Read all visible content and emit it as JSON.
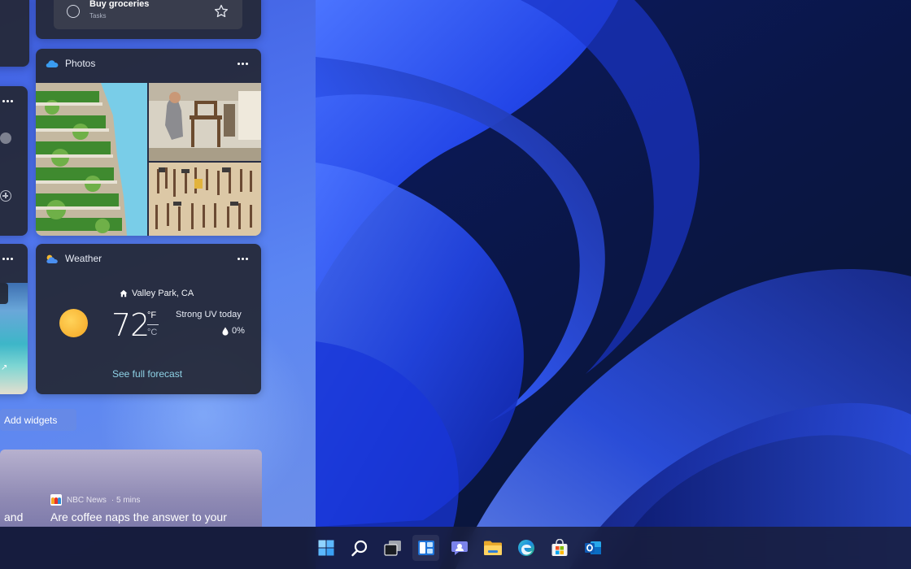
{
  "widgets": {
    "tasks": {
      "item_title": "Buy groceries",
      "item_list": "Tasks"
    },
    "photos": {
      "title": "Photos",
      "icon": "onedrive-cloud-icon"
    },
    "weather": {
      "title": "Weather",
      "icon": "weather-cloud-icon",
      "location": "Valley Park, CA",
      "temperature": "72",
      "unit_f": "°F",
      "unit_c": "°C",
      "condition": "Strong UV today",
      "precipitation": "0%",
      "forecast_link": "See full forecast"
    },
    "add_widgets_label": "Add widgets"
  },
  "news": {
    "left_fragment": "and",
    "source": "NBC News",
    "age": "· 5 mins",
    "headline": "Are coffee naps the answer to your"
  },
  "taskbar": {
    "items": [
      {
        "name": "start-button",
        "icon": "windows-logo-icon"
      },
      {
        "name": "search-button",
        "icon": "search-icon"
      },
      {
        "name": "task-view-button",
        "icon": "task-view-icon"
      },
      {
        "name": "widgets-button",
        "icon": "widgets-icon"
      },
      {
        "name": "chat-button",
        "icon": "teams-chat-icon"
      },
      {
        "name": "file-explorer-button",
        "icon": "folder-icon"
      },
      {
        "name": "edge-button",
        "icon": "edge-icon"
      },
      {
        "name": "store-button",
        "icon": "store-icon"
      },
      {
        "name": "outlook-button",
        "icon": "outlook-icon"
      }
    ]
  },
  "colors": {
    "wallpaper_dark": "#07122e",
    "wallpaper_blue": "#1f3fe0",
    "accent_link": "#8fd2e6",
    "sun": "#f5a623"
  }
}
